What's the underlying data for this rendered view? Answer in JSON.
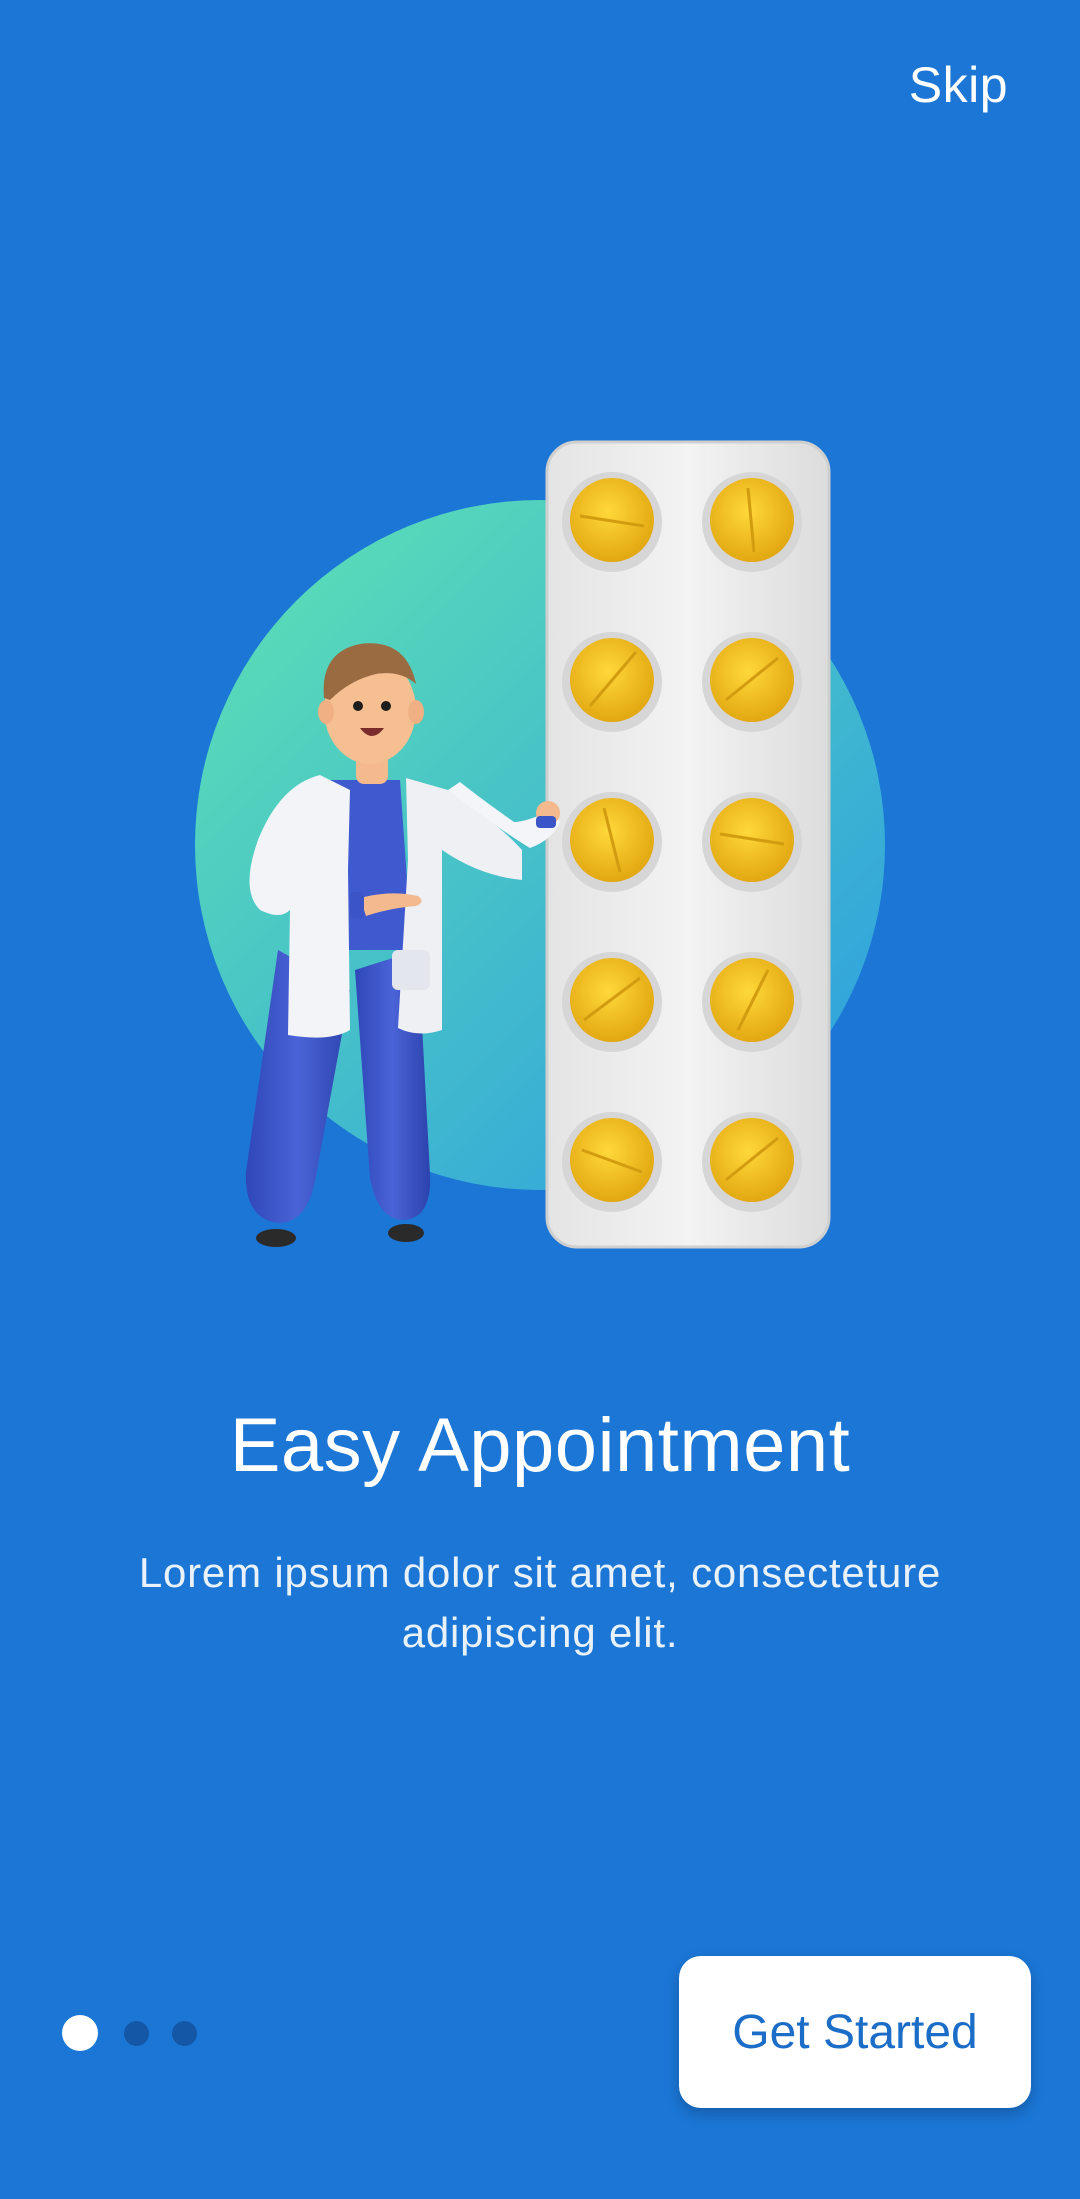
{
  "header": {
    "skip_label": "Skip"
  },
  "illustration": {
    "icon": "doctor-with-pill-blister-illustration"
  },
  "content": {
    "title": "Easy Appointment",
    "description": "Lorem ipsum dolor sit amet, consecteture adipiscing elit."
  },
  "pagination": {
    "current_page": 1,
    "total_pages": 3
  },
  "footer": {
    "cta_label": "Get Started"
  },
  "colors": {
    "background": "#1b76d6",
    "cta_background": "#ffffff",
    "cta_text": "#1b6dc8",
    "dot_active": "#ffffff",
    "dot_inactive": "#1457a6",
    "circle_start": "#5fe0b4",
    "circle_end": "#2f9ee0",
    "pill": "#f1bf1e"
  }
}
